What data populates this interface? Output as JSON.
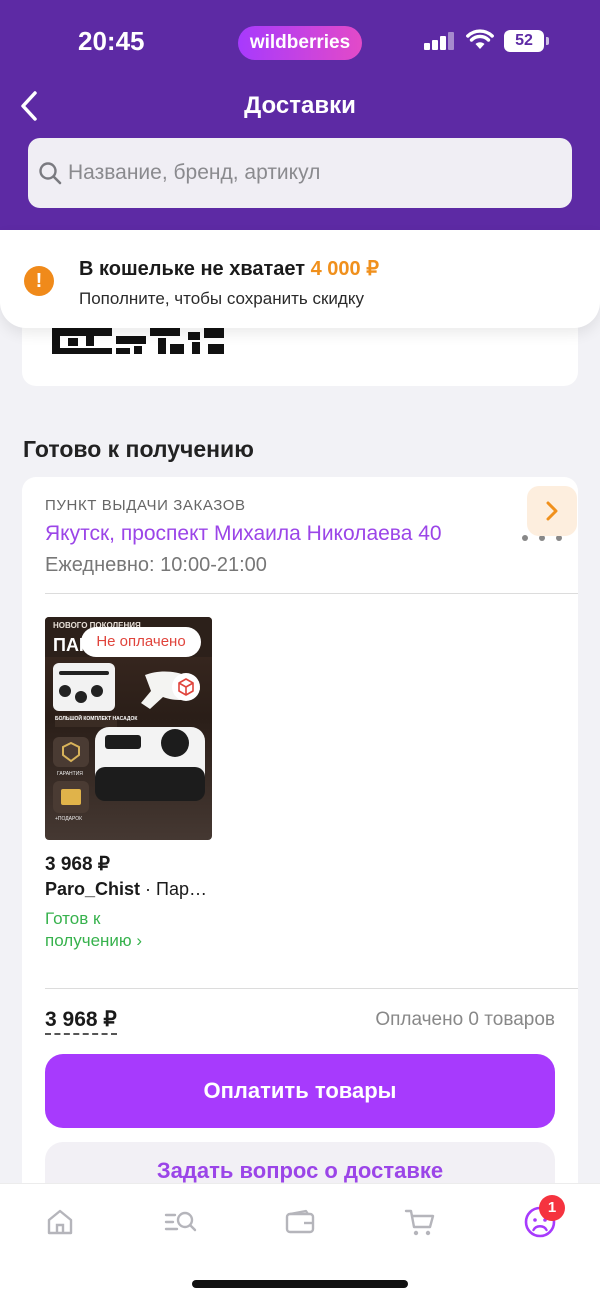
{
  "status_bar": {
    "time": "20:45",
    "brand_pill": "wildberries",
    "battery": "52"
  },
  "header": {
    "title": "Доставки"
  },
  "search": {
    "placeholder": "Название, бренд, артикул"
  },
  "wallet_banner": {
    "title_prefix": "В кошельке не хватает ",
    "amount": "4 000 ₽",
    "subtitle": "Пополните, чтобы сохранить скидку"
  },
  "section": {
    "title": "Готово к получению"
  },
  "pickup": {
    "label": "ПУНКТ ВЫДАЧИ ЗАКАЗОВ",
    "address": "Якутск, проспект Михаила Николаева 40",
    "hours": "Ежедневно: 10:00-21:00"
  },
  "product": {
    "status_pill": "Не оплачено",
    "price": "3 968 ₽",
    "brand": "Paro_Chist",
    "name": " · Пар…",
    "status": "Готов к получению ›",
    "image_texts": {
      "top": "НОВОГО ПОКОЛЕНИЯ",
      "headline": "ПАР",
      "kit": "БОЛЬШОЙ КОМПЛЕКТ НАСАДОК",
      "warranty": "ГАРАНТИЯ",
      "gift": "+ПОДАРОК"
    }
  },
  "totals": {
    "price": "3 968 ₽",
    "paid": "Оплачено 0 товаров"
  },
  "buttons": {
    "pay": "Оплатить товары",
    "question": "Задать вопрос о доставке"
  },
  "tab_bar": {
    "items": [
      "home-icon",
      "catalog-search-icon",
      "wallet-icon",
      "cart-icon",
      "profile-icon"
    ],
    "profile_badge": "1"
  },
  "colors": {
    "header": "#5d2aa4",
    "accent": "#a73afd",
    "warning": "#f08a1a",
    "success": "#37b24d",
    "error": "#e0443c"
  }
}
